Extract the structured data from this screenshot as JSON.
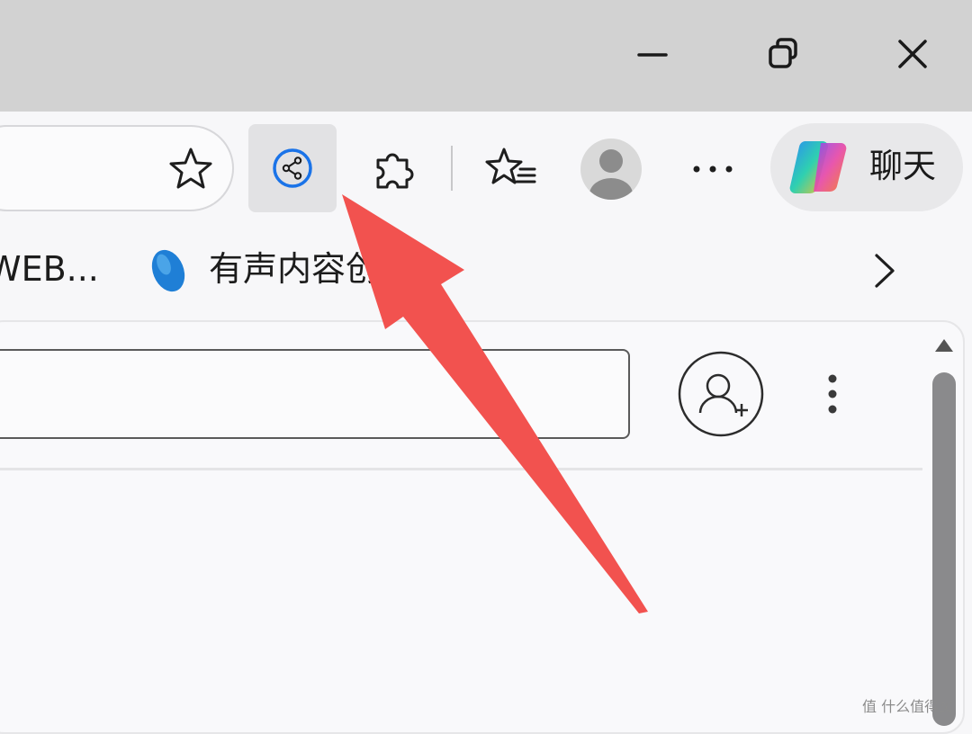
{
  "titlebar": {
    "minimize_icon": "minimize-icon",
    "restore_icon": "restore-icon",
    "close_icon": "close-icon"
  },
  "toolbar": {
    "favorite_icon": "star-icon",
    "share_icon": "share-icon",
    "extensions_icon": "puzzle-icon",
    "favorites_icon": "favorites-list-icon",
    "profile_icon": "avatar",
    "more_icon": "more-horizontal-icon",
    "chat_label": "聊天",
    "accent_color": "#1a73e8"
  },
  "favorites_bar": {
    "items": [
      {
        "label": "WEB..."
      },
      {
        "label": "有声内容创"
      }
    ],
    "next_icon": "chevron-right-icon"
  },
  "content": {
    "search_value": "",
    "add_profile_icon": "add-person-icon",
    "menu_icon": "more-vertical-icon"
  },
  "annotation": {
    "arrow_color": "#f2524f"
  },
  "watermark": {
    "text": "值 什么值得买"
  }
}
